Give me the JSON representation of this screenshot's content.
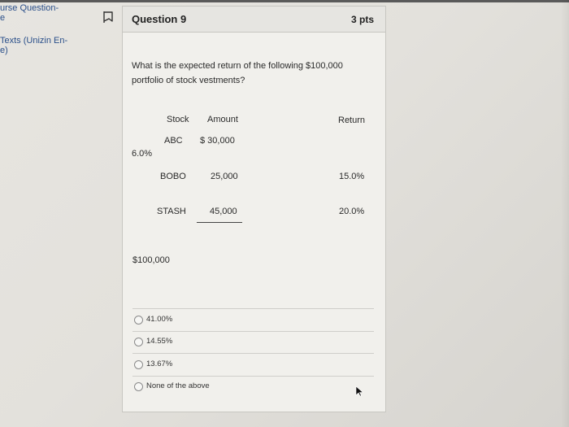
{
  "sidebar": {
    "links": [
      {
        "label": "urse Question-"
      },
      {
        "label": "e"
      },
      {
        "label": "Texts (Unizin En-"
      },
      {
        "label": "e)"
      }
    ]
  },
  "question": {
    "title": "Question 9",
    "points": "3 pts",
    "text": "What is the expected return of the following $100,000 portfolio of stock vestments?",
    "table": {
      "headers": {
        "stock": "Stock",
        "amount": "Amount",
        "return": "Return"
      },
      "rows": [
        {
          "stock": "ABC",
          "amount": "$ 30,000",
          "return": "6.0%"
        },
        {
          "stock": "BOBO",
          "amount": "25,000",
          "return": "15.0%"
        },
        {
          "stock": "STASH",
          "amount": "45,000",
          "return": "20.0%"
        }
      ],
      "total": "$100,000"
    },
    "answers": [
      {
        "label": "41.00%"
      },
      {
        "label": "14.55%"
      },
      {
        "label": "13.67%"
      },
      {
        "label": "None of the above"
      }
    ]
  },
  "icons": {
    "flag": "flag-icon",
    "cursor": "mouse-cursor-icon"
  }
}
